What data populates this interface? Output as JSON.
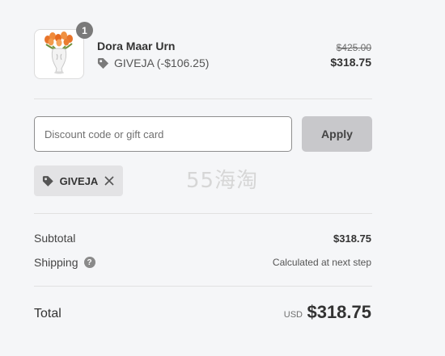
{
  "product": {
    "name": "Dora Maar Urn",
    "quantity": "1",
    "discount_code": "GIVEJA",
    "discount_amount": "(-$106.25)",
    "original_price": "$425.00",
    "price": "$318.75",
    "image_icon": "vase-with-tulips-image"
  },
  "discount": {
    "placeholder": "Discount code or gift card",
    "value": "",
    "apply_label": "Apply",
    "applied_code": "GIVEJA"
  },
  "watermark": "55海淘",
  "summary": {
    "subtotal_label": "Subtotal",
    "subtotal_value": "$318.75",
    "shipping_label": "Shipping",
    "shipping_help_icon": "question-mark-icon",
    "shipping_value": "Calculated at next step",
    "total_label": "Total",
    "currency": "USD",
    "total_value": "$318.75"
  },
  "colors": {
    "background": "#f5f6f8",
    "apply_button": "#c8c8cb",
    "chip": "#e3e3e5",
    "badge": "#7a7a7a"
  }
}
